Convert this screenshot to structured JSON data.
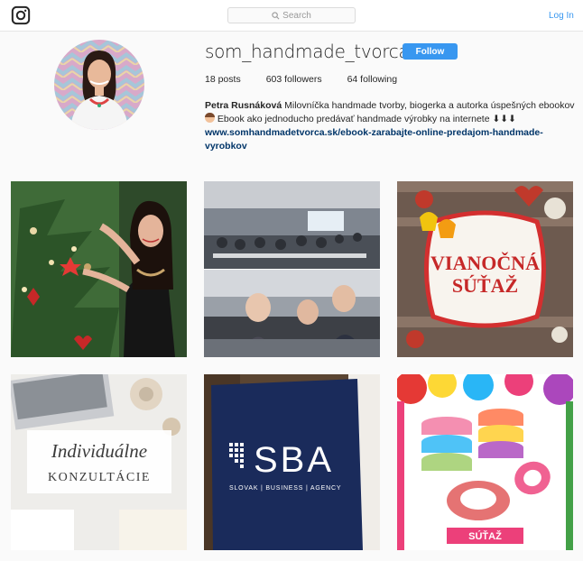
{
  "header": {
    "search_placeholder": "Search",
    "login_label": "Log In"
  },
  "profile": {
    "username": "som_handmade_tvorca",
    "follow_label": "Follow",
    "stats": {
      "posts": "18 posts",
      "followers": "603 followers",
      "following": "64 following"
    },
    "full_name": "Petra Rusnáková",
    "bio_line1": " Milovníčka handmade tvorby, biogerka a autorka úspešných ebookov",
    "bio_line2": " Ebook ako jednoducho predávať handmade výrobky na internete ⬇⬇⬇",
    "website_line1": "www.somhandmadetvorca.sk/ebook-zarabajte-online-predajom-handmade-",
    "website_line2": "vyrobkov"
  },
  "posts": {
    "p3_line1": "VIANOČNÁ",
    "p3_line2": "SÚŤAŽ",
    "p4_line1": "Individuálne",
    "p4_line2": "KONZULTÁCIE",
    "p5_brand": "SBA",
    "p5_sub": "SLOVAK | BUSINESS | AGENCY",
    "p6_label": "SÚŤAŽ"
  },
  "colors": {
    "accent": "#3897f0",
    "link": "#003569"
  }
}
